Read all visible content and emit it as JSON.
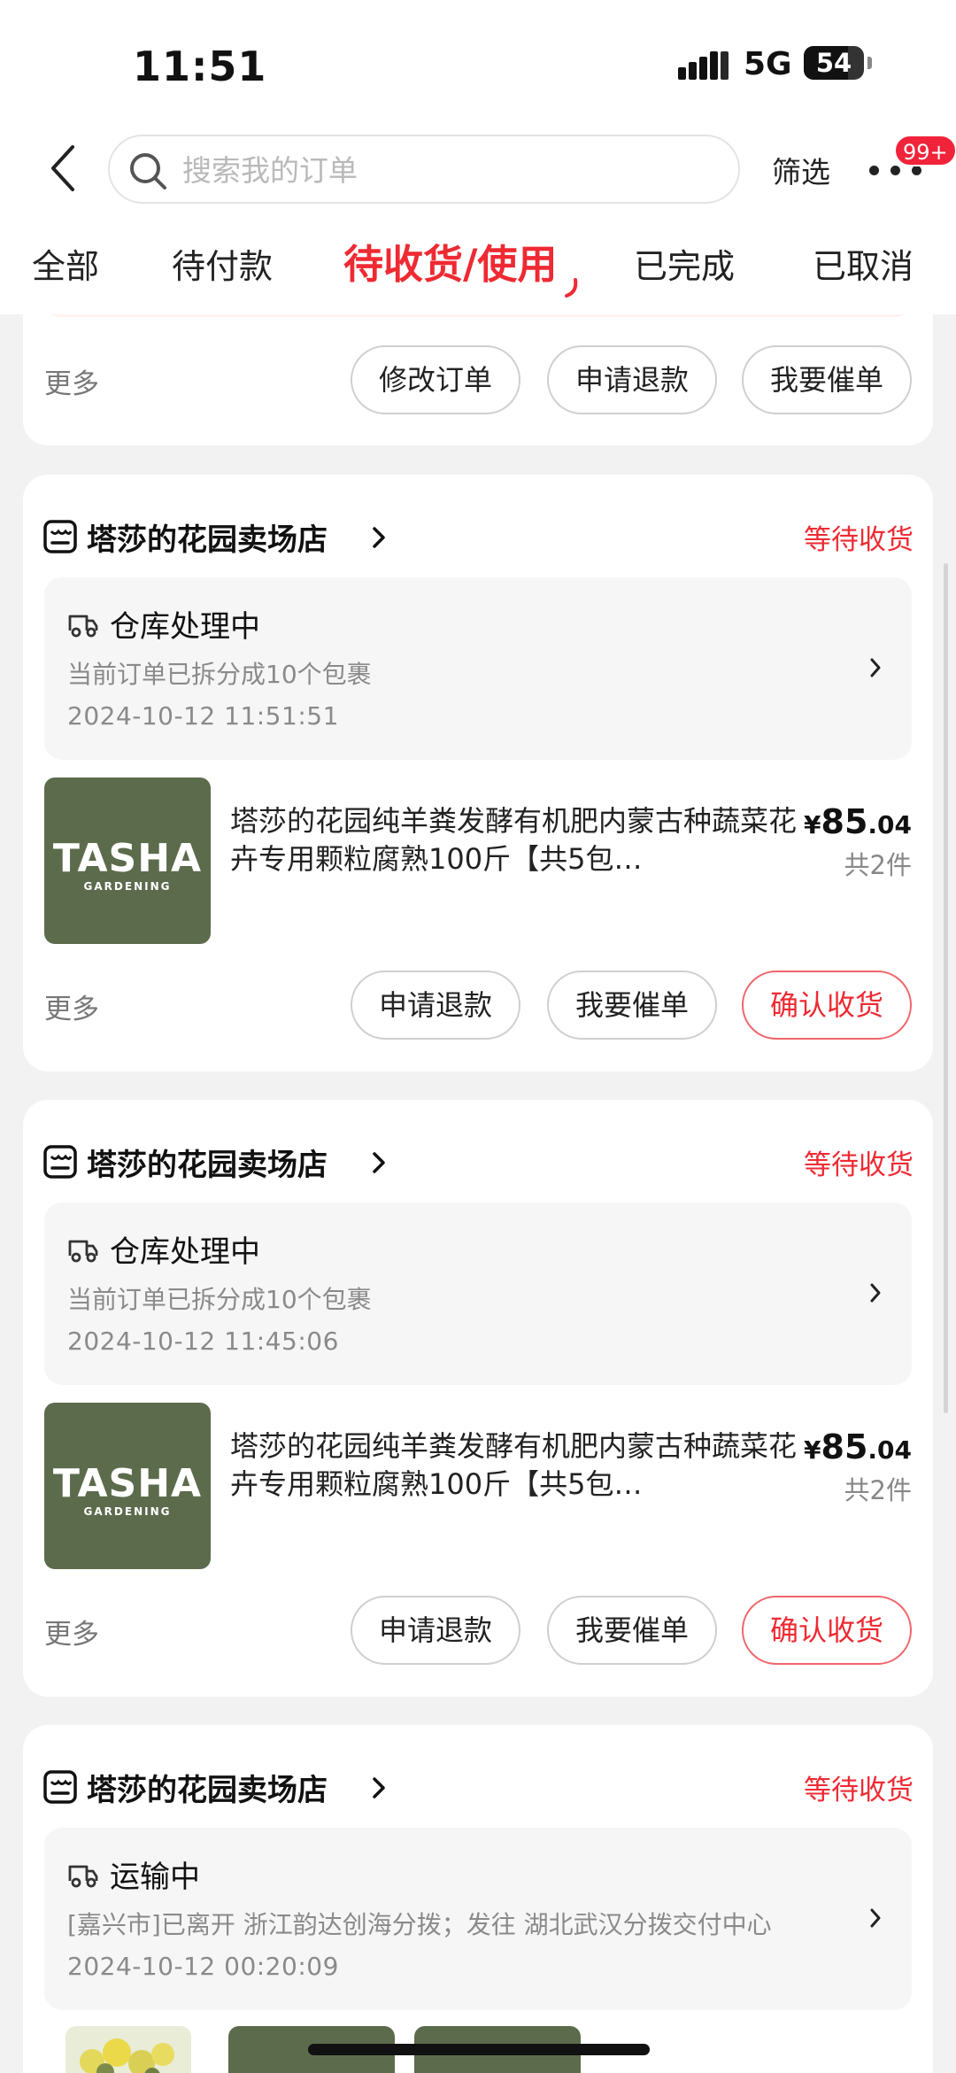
{
  "status_bar": {
    "time": "11:51",
    "network": "5G",
    "battery": "54"
  },
  "header": {
    "search_placeholder": "搜索我的订单",
    "filter_label": "筛选",
    "message_badge": "99+"
  },
  "tabs": [
    {
      "label": "全部"
    },
    {
      "label": "待付款"
    },
    {
      "label": "待收货/使用",
      "active": true
    },
    {
      "label": "已完成"
    },
    {
      "label": "已取消"
    }
  ],
  "top_card": {
    "more_label": "更多",
    "buttons": [
      "修改订单",
      "申请退款",
      "我要催单"
    ]
  },
  "orders": [
    {
      "shop_name": "塔莎的花园卖场店",
      "status": "等待收货",
      "logistics": {
        "title": "仓库处理中",
        "description": "当前订单已拆分成10个包裹",
        "time": "2024-10-12 11:51:51"
      },
      "product": {
        "image_brand": "TASHA",
        "image_sub": "GARDENING",
        "title": "塔莎的花园纯羊粪发酵有机肥内蒙古种蔬菜花卉专用颗粒腐熟100斤【共5包…",
        "price_currency": "¥",
        "price_int": "85",
        "price_dec": ".04",
        "quantity": "共2件"
      },
      "more_label": "更多",
      "buttons": [
        "申请退款",
        "我要催单",
        "确认收货"
      ]
    },
    {
      "shop_name": "塔莎的花园卖场店",
      "status": "等待收货",
      "logistics": {
        "title": "仓库处理中",
        "description": "当前订单已拆分成10个包裹",
        "time": "2024-10-12 11:45:06"
      },
      "product": {
        "image_brand": "TASHA",
        "image_sub": "GARDENING",
        "title": "塔莎的花园纯羊粪发酵有机肥内蒙古种蔬菜花卉专用颗粒腐熟100斤【共5包…",
        "price_currency": "¥",
        "price_int": "85",
        "price_dec": ".04",
        "quantity": "共2件"
      },
      "more_label": "更多",
      "buttons": [
        "申请退款",
        "我要催单",
        "确认收货"
      ]
    },
    {
      "shop_name": "塔莎的花园卖场店",
      "status": "等待收货",
      "logistics": {
        "title": "运输中",
        "description": "[嘉兴市]已离开 浙江韵达创海分拨；发往 湖北武汉分拨交付中心",
        "time": "2024-10-12 00:20:09"
      }
    }
  ],
  "colors": {
    "accent": "#ee2a33",
    "badge": "#f0233a",
    "product_image_bg": "#5d6b4d",
    "page_bg": "#f2f2f2"
  }
}
